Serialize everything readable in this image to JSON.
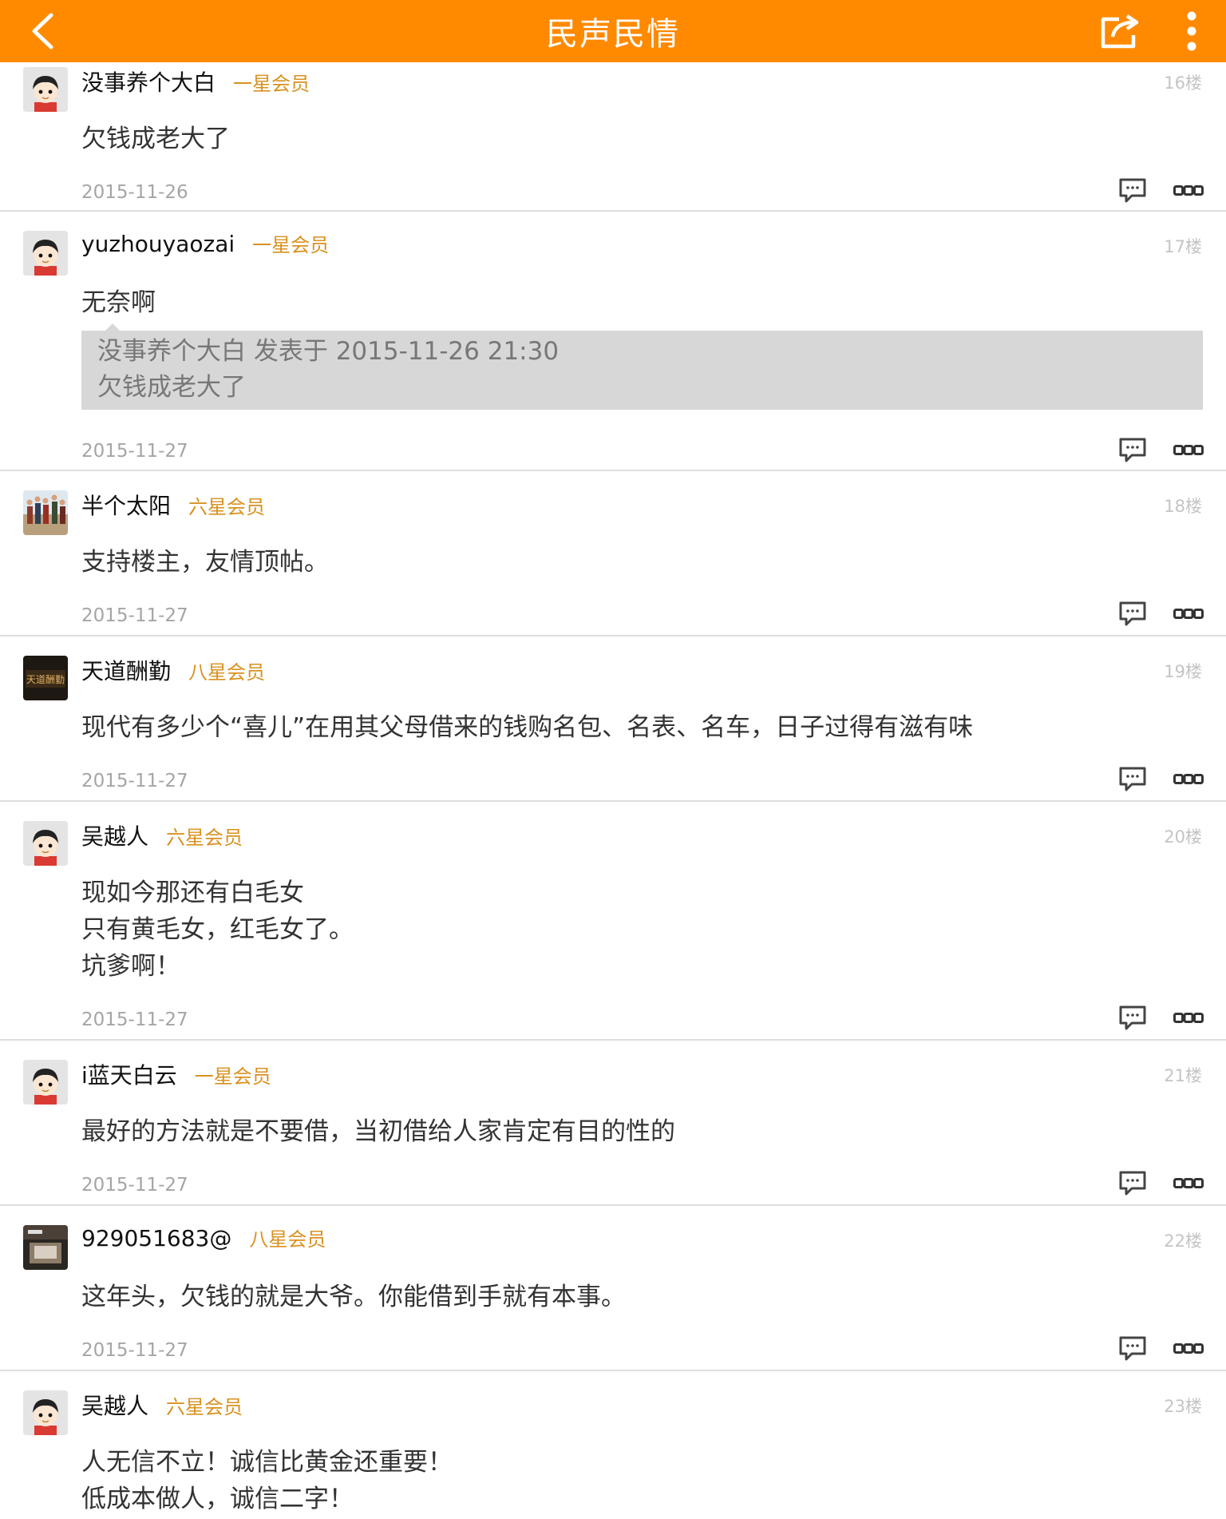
{
  "header": {
    "title": "民声民情",
    "back_icon": "chevron-left-icon",
    "share_icon": "share-icon",
    "more_icon": "vertical-dots-icon"
  },
  "posts": [
    {
      "username": "没事养个大白",
      "level": "一星会员",
      "floor": "16楼",
      "lines": [
        "欠钱成老大了"
      ],
      "date": "2015-11-26",
      "avatar": "cartoon-avatar"
    },
    {
      "username": "yuzhouyaozai",
      "level": "一星会员",
      "floor": "17楼",
      "lines": [
        "无奈啊"
      ],
      "quote": {
        "header": "没事养个大白 发表于 2015-11-26 21:30",
        "text": "欠钱成老大了"
      },
      "date": "2015-11-27",
      "avatar": "cartoon-avatar"
    },
    {
      "username": "半个太阳",
      "level": "六星会员",
      "floor": "18楼",
      "lines": [
        "支持楼主，友情顶帖。"
      ],
      "date": "2015-11-27",
      "avatar": "photo-avatar-group"
    },
    {
      "username": "天道酬勤",
      "level": "八星会员",
      "floor": "19楼",
      "lines": [
        "现代有多少个“喜儿”在用其父母借来的钱购名包、名表、名车，日子过得有滋有味"
      ],
      "date": "2015-11-27",
      "avatar": "calligraphy-avatar"
    },
    {
      "username": "吴越人",
      "level": "六星会员",
      "floor": "20楼",
      "lines": [
        "现如今那还有白毛女",
        "只有黄毛女，红毛女了。",
        "坑爹啊！"
      ],
      "date": "2015-11-27",
      "avatar": "cartoon-avatar"
    },
    {
      "username": "i蓝天白云",
      "level": "一星会员",
      "floor": "21楼",
      "lines": [
        "最好的方法就是不要借，当初借给人家肯定有目的性的"
      ],
      "date": "2015-11-27",
      "avatar": "cartoon-avatar"
    },
    {
      "username": "929051683@",
      "level": "八星会员",
      "floor": "22楼",
      "lines": [
        "这年头，欠钱的就是大爷。你能借到手就有本事。"
      ],
      "date": "2015-11-27",
      "avatar": "photo-avatar-dark"
    },
    {
      "username": "吴越人",
      "level": "六星会员",
      "floor": "23楼",
      "lines": [
        "人无信不立！诚信比黄金还重要！",
        "低成本做人，诚信二字！"
      ],
      "date": "",
      "avatar": "cartoon-avatar"
    }
  ],
  "colors": {
    "header_bg": "#ff8a00",
    "level_text": "#d9911f",
    "quote_bg": "#d7d7d7"
  }
}
